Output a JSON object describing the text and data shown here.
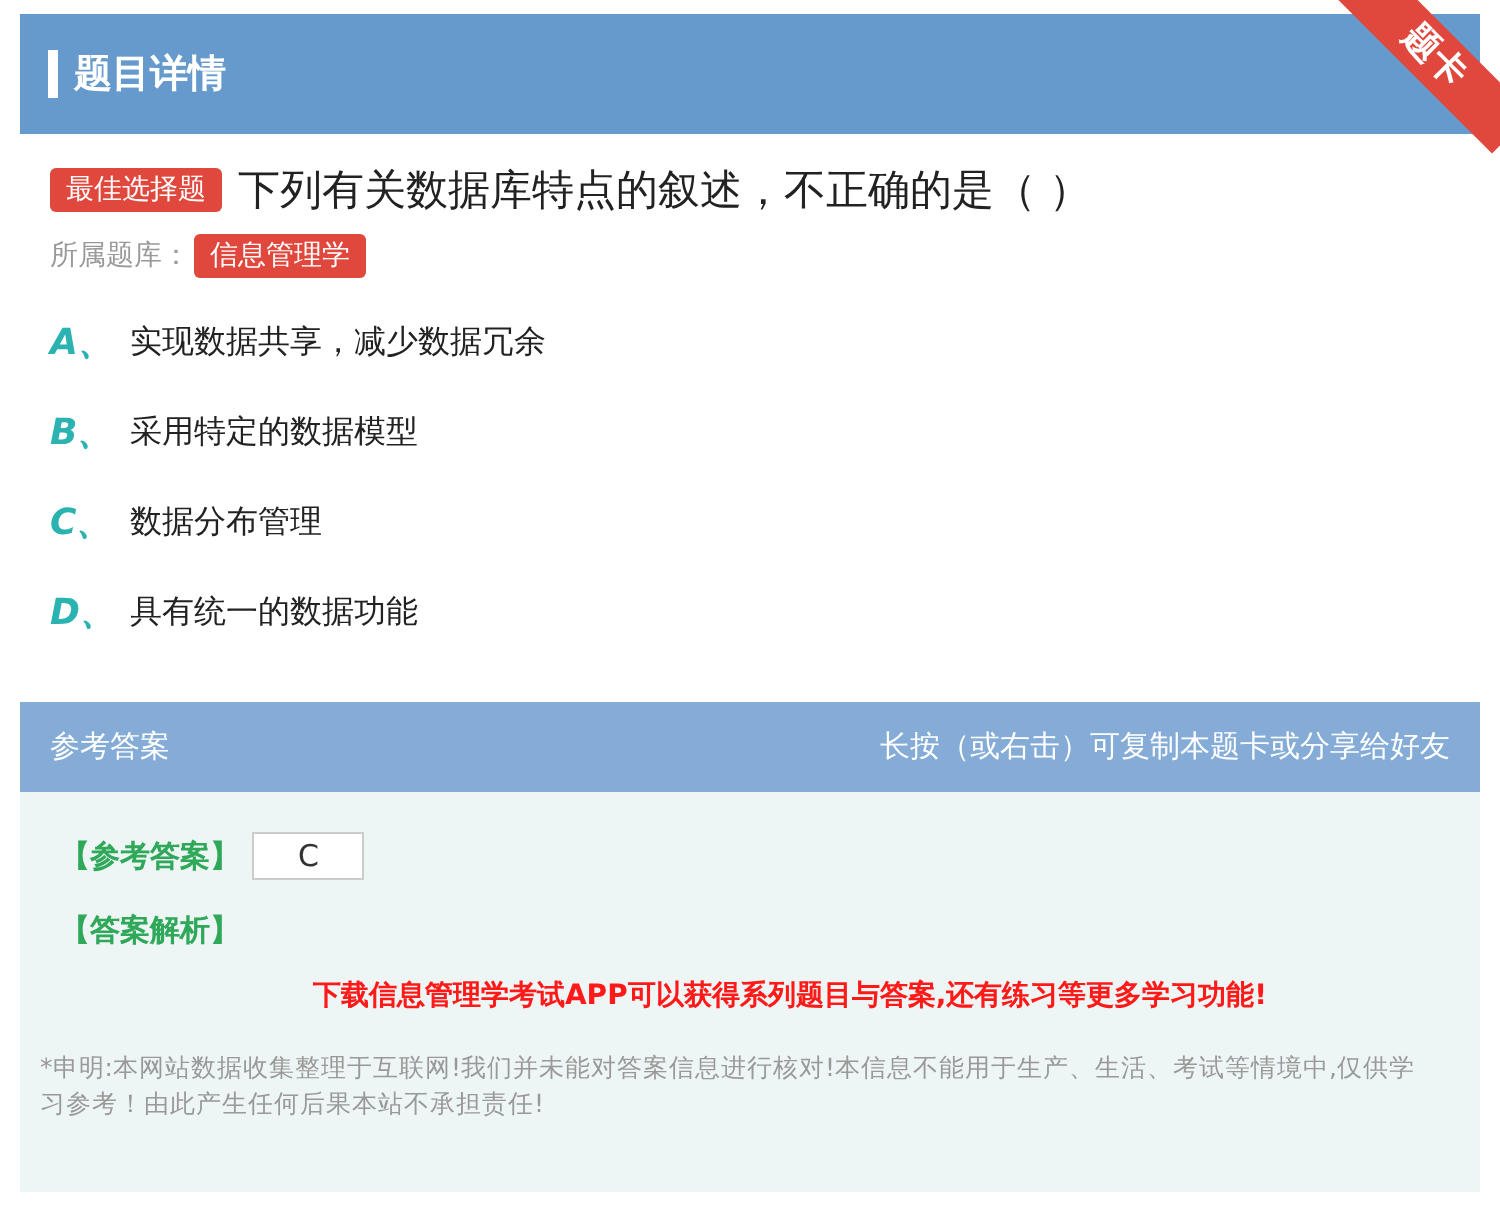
{
  "header": {
    "title": "题目详情",
    "ribbon": "题卡"
  },
  "question": {
    "type_tag": "最佳选择题",
    "text": "下列有关数据库特点的叙述，不正确的是（ ）",
    "bank_label": "所属题库：",
    "bank": "信息管理学"
  },
  "options": [
    {
      "letter": "A",
      "sep": "、",
      "text": "实现数据共享，减少数据冗余"
    },
    {
      "letter": "B",
      "sep": "、",
      "text": "采用特定的数据模型"
    },
    {
      "letter": "C",
      "sep": "、",
      "text": "数据分布管理"
    },
    {
      "letter": "D",
      "sep": "、",
      "text": "具有统一的数据功能"
    }
  ],
  "answer_section": {
    "title": "参考答案",
    "hint": "长按（或右击）可复制本题卡或分享给好友",
    "answer_label": "【参考答案】",
    "answer": "C",
    "analysis_label": "【答案解析】",
    "promo": "下载信息管理学考试APP可以获得系列题目与答案,还有练习等更多学习功能!",
    "disclaimer": "*申明:本网站数据收集整理于互联网!我们并未能对答案信息进行核对!本信息不能用于生产、生活、考试等情境中,仅供学习参考！由此产生任何后果本站不承担责任!"
  }
}
